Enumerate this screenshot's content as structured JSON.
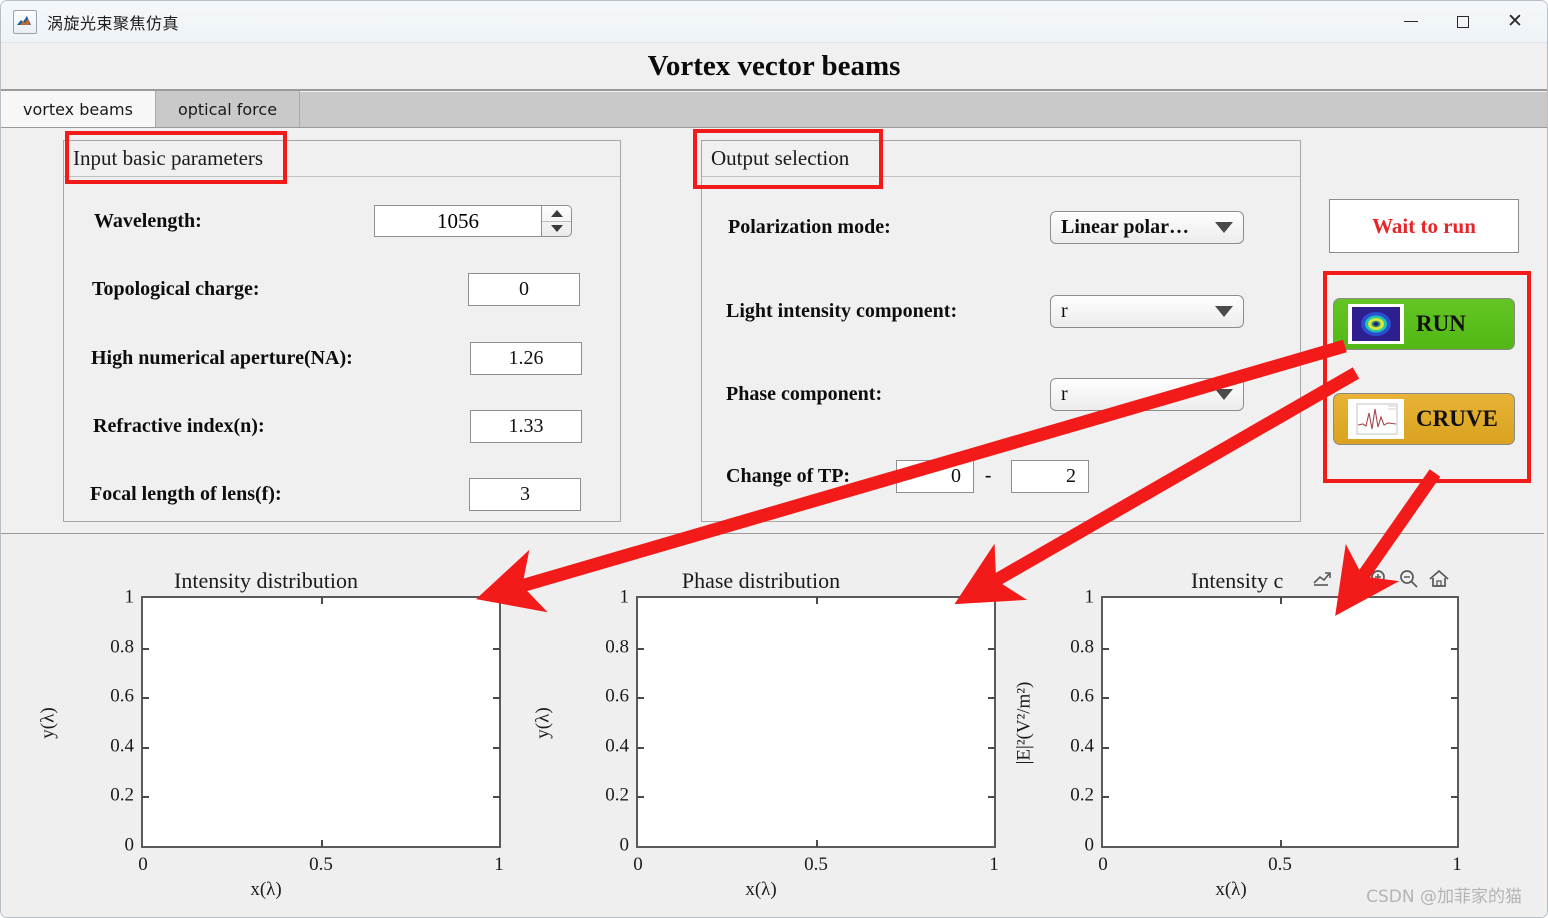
{
  "window": {
    "title": "涡旋光束聚焦仿真",
    "app_icon": "matlab-icon",
    "controls": {
      "minimize": "minimize-icon",
      "maximize": "maximize-icon",
      "close": "close-icon"
    }
  },
  "header": {
    "title": "Vortex vector beams"
  },
  "tabs": [
    {
      "label": "vortex beams",
      "active": true
    },
    {
      "label": "optical force",
      "active": false
    }
  ],
  "input_panel": {
    "title": "Input basic parameters",
    "fields": [
      {
        "label": "Wavelength:",
        "value": "1056",
        "type": "spinner"
      },
      {
        "label": "Topological charge:",
        "value": "0",
        "type": "text"
      },
      {
        "label": "High numerical aperture(NA):",
        "value": "1.26",
        "type": "text"
      },
      {
        "label": "Refractive index(n):",
        "value": "1.33",
        "type": "text"
      },
      {
        "label": "Focal length of lens(f):",
        "value": "3",
        "type": "text"
      }
    ]
  },
  "output_panel": {
    "title": "Output selection",
    "fields": [
      {
        "label": "Polarization mode:",
        "value": "Linear polar…",
        "type": "dropdown"
      },
      {
        "label": "Light intensity component:",
        "value": "r",
        "type": "dropdown"
      },
      {
        "label": "Phase component:",
        "value": "r",
        "type": "dropdown"
      }
    ],
    "tp_row": {
      "label": "Change of TP:",
      "from": "0",
      "separator": "-",
      "to": "2"
    }
  },
  "actions": {
    "status": "Wait to run",
    "status_color": "#e8262a",
    "run": {
      "label": "RUN",
      "color": "#59bd1b",
      "icon": "vortex-beam-thumbnail"
    },
    "curve": {
      "label": "CRUVE",
      "color": "#dfa728",
      "icon": "curve-plot-thumbnail"
    }
  },
  "plots": [
    {
      "title": "Intensity distribution",
      "xlabel": "x(λ)",
      "ylabel": "y(λ)",
      "xticks": [
        "0",
        "0.5",
        "1"
      ],
      "yticks": [
        "0",
        "0.2",
        "0.4",
        "0.6",
        "0.8",
        "1"
      ],
      "toolbar": []
    },
    {
      "title": "Phase distribution",
      "xlabel": "x(λ)",
      "ylabel": "y(λ)",
      "xticks": [
        "0",
        "0.5",
        "1"
      ],
      "yticks": [
        "0",
        "0.2",
        "0.4",
        "0.6",
        "0.8",
        "1"
      ],
      "toolbar": []
    },
    {
      "title": "Intensity c",
      "xlabel": "x(λ)",
      "ylabel": "|E|²(V²/m²)",
      "xticks": [
        "0",
        "0.5",
        "1"
      ],
      "yticks": [
        "0",
        "0.2",
        "0.4",
        "0.6",
        "0.8",
        "1"
      ],
      "toolbar": [
        "export-icon",
        "pan-icon",
        "zoom-in-icon",
        "zoom-out-icon",
        "home-icon"
      ]
    }
  ],
  "chart_data": [
    {
      "type": "scatter",
      "title": "Intensity distribution",
      "xlabel": "x(λ)",
      "ylabel": "y(λ)",
      "xlim": [
        0,
        1
      ],
      "ylim": [
        0,
        1
      ],
      "xticks": [
        0,
        0.5,
        1
      ],
      "yticks": [
        0,
        0.2,
        0.4,
        0.6,
        0.8,
        1
      ],
      "series": [],
      "grid": false,
      "legend": false
    },
    {
      "type": "scatter",
      "title": "Phase distribution",
      "xlabel": "x(λ)",
      "ylabel": "y(λ)",
      "xlim": [
        0,
        1
      ],
      "ylim": [
        0,
        1
      ],
      "xticks": [
        0,
        0.5,
        1
      ],
      "yticks": [
        0,
        0.2,
        0.4,
        0.6,
        0.8,
        1
      ],
      "series": [],
      "grid": false,
      "legend": false
    },
    {
      "type": "line",
      "title": "Intensity c",
      "xlabel": "x(λ)",
      "ylabel": "|E|²(V²/m²)",
      "xlim": [
        0,
        1
      ],
      "ylim": [
        0,
        1
      ],
      "xticks": [
        0,
        0.5,
        1
      ],
      "yticks": [
        0,
        0.2,
        0.4,
        0.6,
        0.8,
        1
      ],
      "series": [],
      "grid": false,
      "legend": false
    }
  ],
  "annotations": {
    "box_color": "#f31a1a",
    "arrow_color": "#f31a1a",
    "boxes": [
      "input-basic-parameters-title",
      "output-selection-title",
      "run-curve-buttons"
    ],
    "arrows": [
      "run-to-intensity-plot",
      "run-to-phase-plot",
      "curve-to-intensity-curve-plot"
    ]
  },
  "watermark": {
    "text": "CSDN @加菲家的猫"
  }
}
